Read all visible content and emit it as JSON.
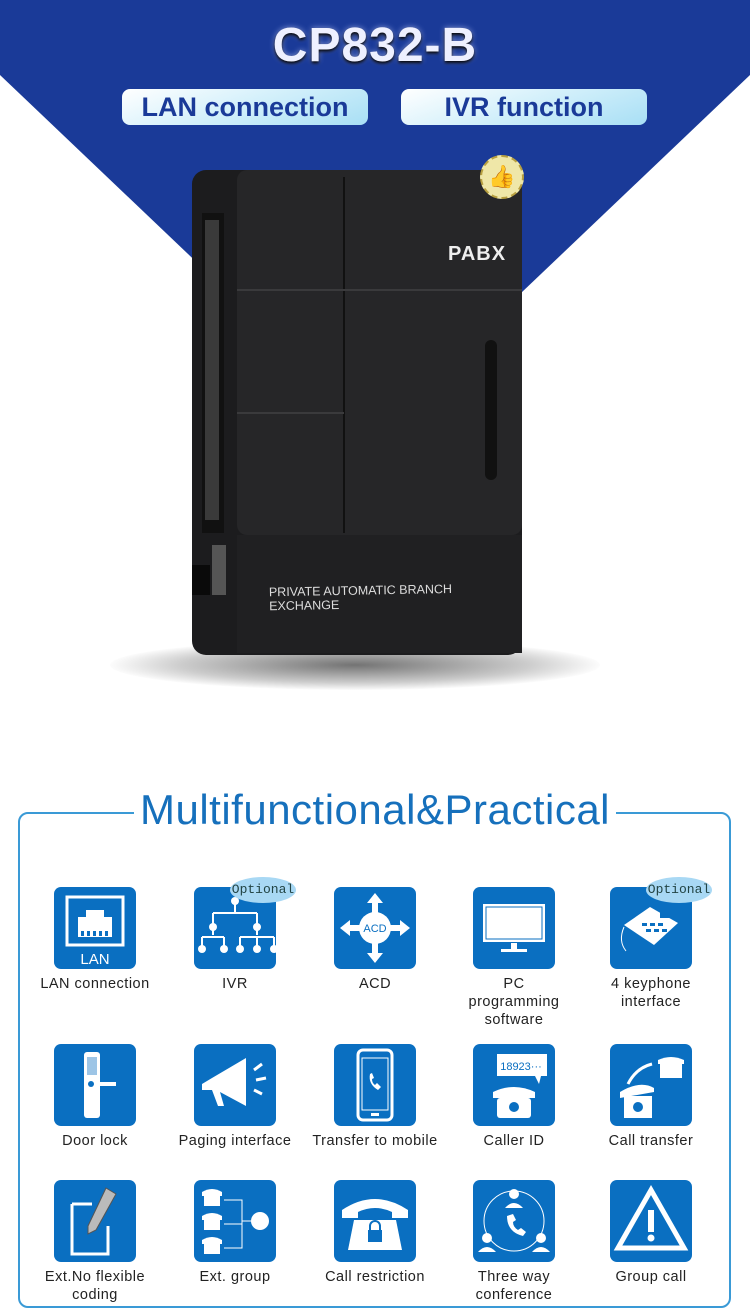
{
  "header": {
    "title": "CP832-B",
    "pills": [
      "LAN connection",
      "IVR function"
    ],
    "bg_color": "#1a3a98"
  },
  "product": {
    "brand": "PABX",
    "subtitle": "PRIVATE AUTOMATIC BRANCH EXCHANGE",
    "badge_icon": "thumbs-up-icon"
  },
  "features": {
    "title": "Multifunctional&Practical",
    "accent": "#0a6fc1",
    "optional_label": "Optional",
    "items": [
      {
        "label": "LAN connection",
        "icon": "lan-port-icon",
        "icon_text": "LAN"
      },
      {
        "label": "IVR",
        "icon": "ivr-tree-icon",
        "optional": true
      },
      {
        "label": "ACD",
        "icon": "acd-arrows-icon",
        "icon_text": "ACD"
      },
      {
        "label": "PC programming software",
        "icon": "monitor-icon"
      },
      {
        "label": "4 keyphone interface",
        "icon": "keyphone-icon",
        "optional": true
      },
      {
        "label": "Door lock",
        "icon": "door-lock-icon"
      },
      {
        "label": "Paging interface",
        "icon": "megaphone-icon"
      },
      {
        "label": "Transfer to mobile",
        "icon": "mobile-phone-icon"
      },
      {
        "label": "Caller ID",
        "icon": "caller-id-icon",
        "icon_text": "18923···"
      },
      {
        "label": "Call transfer",
        "icon": "call-transfer-icon"
      },
      {
        "label": "Ext.No flexible coding",
        "icon": "pencil-edit-icon"
      },
      {
        "label": "Ext. group",
        "icon": "ext-group-icon"
      },
      {
        "label": "Call restriction",
        "icon": "phone-lock-icon"
      },
      {
        "label": "Three way conference",
        "icon": "conference-icon"
      },
      {
        "label": "Group call",
        "icon": "warning-triangle-icon"
      }
    ]
  }
}
